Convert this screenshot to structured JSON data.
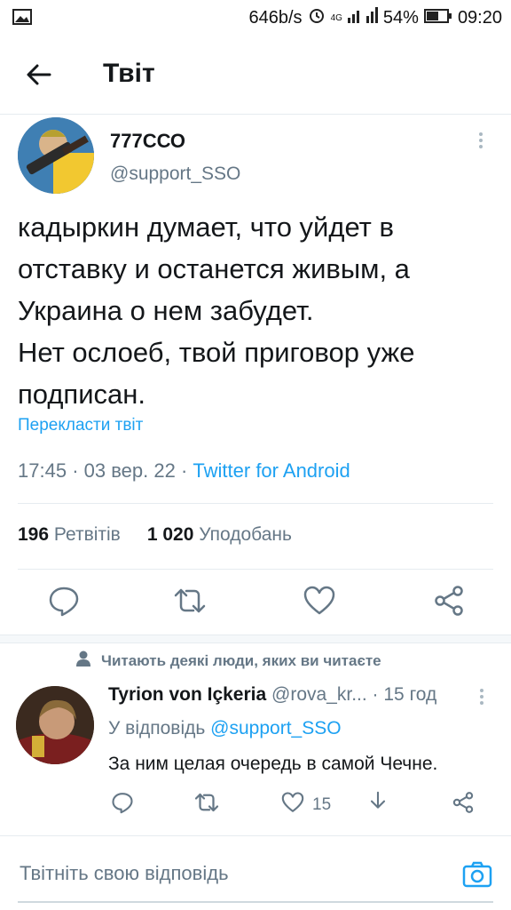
{
  "status_bar": {
    "speed": "646b/s",
    "network": "4G",
    "battery": "54%",
    "time": "09:20"
  },
  "header": {
    "title": "Твіт"
  },
  "tweet": {
    "author_name": "777ССО",
    "author_handle": "@support_SSO",
    "text": "кадыркин думает, что уйдет в\nотставку и останется живым, а\nУкраина о нем забудет.\nНет ослоеб, твой приговор уже\nподписан.",
    "translate_label": "Перекласти твіт",
    "time": "17:45",
    "date": "03 вер. 22",
    "client": "Twitter for Android",
    "retweets_count": "196",
    "retweets_label": "Ретвітів",
    "likes_count": "1 020",
    "likes_label": "Уподобань"
  },
  "social_context": {
    "text": "Читають деякі люди, яких ви читаєте"
  },
  "reply": {
    "author_name": "Tyrion von Içkeria",
    "author_handle": "@rova_kr...",
    "time": "· 15 год",
    "replying_prefix": "У відповідь",
    "replying_to": "@support_SSO",
    "text": "За ним целая очередь в самой Чечне.",
    "likes": "15"
  },
  "composer": {
    "placeholder": "Твітніть свою відповідь"
  },
  "icons": {
    "back": "arrow-left-icon",
    "more": "more-vertical-icon",
    "reply": "comment-icon",
    "retweet": "retweet-icon",
    "like": "heart-icon",
    "share": "share-icon",
    "person": "person-icon",
    "camera": "camera-icon"
  },
  "colors": {
    "accent": "#1da1f2",
    "text": "#14171a",
    "secondary": "#657786",
    "divider": "#e6ecf0"
  }
}
